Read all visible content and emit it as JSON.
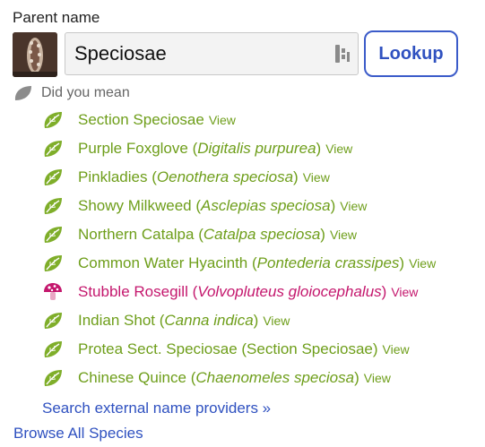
{
  "field": {
    "label": "Parent name",
    "value": "Speciosae",
    "lookup_label": "Lookup"
  },
  "did_you_mean": {
    "label": "Did you mean"
  },
  "colors": {
    "plant": "#6e9e1a",
    "fungi": "#c4176d",
    "link": "#2f51c0"
  },
  "suggestions": [
    {
      "icon": "plant-leaf-icon",
      "kind": "plant",
      "common": "Section Speciosae",
      "scientific": "",
      "view": "View"
    },
    {
      "icon": "plant-leaf-icon",
      "kind": "plant",
      "common": "Purple Foxglove",
      "scientific": "Digitalis purpurea",
      "view": "View"
    },
    {
      "icon": "plant-leaf-icon",
      "kind": "plant",
      "common": "Pinkladies",
      "scientific": "Oenothera speciosa",
      "view": "View"
    },
    {
      "icon": "plant-leaf-icon",
      "kind": "plant",
      "common": "Showy Milkweed",
      "scientific": "Asclepias speciosa",
      "view": "View"
    },
    {
      "icon": "plant-leaf-icon",
      "kind": "plant",
      "common": "Northern Catalpa",
      "scientific": "Catalpa speciosa",
      "view": "View"
    },
    {
      "icon": "plant-leaf-icon",
      "kind": "plant",
      "common": "Common Water Hyacinth",
      "scientific": "Pontederia crassipes",
      "view": "View"
    },
    {
      "icon": "mushroom-icon",
      "kind": "fungi",
      "common": "Stubble Rosegill",
      "scientific": "Volvopluteus gloiocephalus",
      "view": "View"
    },
    {
      "icon": "plant-leaf-icon",
      "kind": "plant",
      "common": "Indian Shot",
      "scientific": "Canna indica",
      "view": "View"
    },
    {
      "icon": "plant-leaf-icon",
      "kind": "plant",
      "common": "Protea Sect. Speciosae (Section Speciosae)",
      "scientific": "",
      "view": "View"
    },
    {
      "icon": "plant-leaf-icon",
      "kind": "plant",
      "common": "Chinese Quince",
      "scientific": "Chaenomeles speciosa",
      "view": "View"
    }
  ],
  "links": {
    "search_external": "Search external name providers »",
    "browse_all": "Browse All Species"
  }
}
